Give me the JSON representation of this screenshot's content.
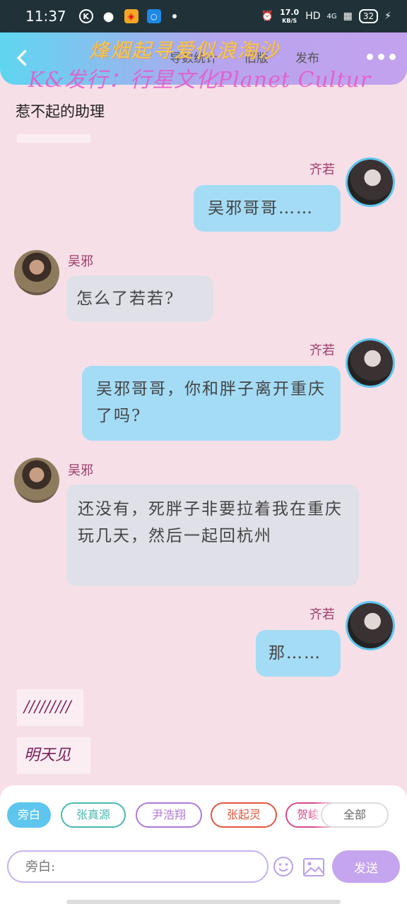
{
  "status_bar": {
    "time": "11:37",
    "speed_value": "17.0",
    "speed_unit": "KB/S",
    "network": "HD",
    "signal": "4G",
    "battery": "32"
  },
  "header": {
    "watermark_title": "烽烟起寻爱似浪淘沙",
    "watermark_credit": "K&发行：行星文化Planet Cultur",
    "tabs": [
      "导数统计",
      "旧版",
      "发布"
    ]
  },
  "chat": {
    "top_note": "惹不起的助理",
    "messages": [
      {
        "sender": "齐若",
        "text": "吴邪哥哥……",
        "side": "me"
      },
      {
        "sender": "吴邪",
        "text": "怎么了若若?",
        "side": "other"
      },
      {
        "sender": "齐若",
        "text": "吴邪哥哥，你和胖子离开重庆了吗?",
        "side": "me"
      },
      {
        "sender": "吴邪",
        "text": "还没有，死胖子非要拉着我在重庆玩几天，然后一起回杭州",
        "side": "other"
      },
      {
        "sender": "齐若",
        "text": "那……",
        "side": "me"
      }
    ],
    "system_notes": [
      "/////////",
      "明天见"
    ]
  },
  "composer": {
    "chips": [
      {
        "label": "旁白",
        "color": "#5ec6ee"
      },
      {
        "label": "张真源",
        "color": "#4ab9b0"
      },
      {
        "label": "尹浩翔",
        "color": "#b07ad6"
      },
      {
        "label": "张起灵",
        "color": "#e0583f"
      },
      {
        "label": "贺峻",
        "color": "#d64a8a"
      },
      {
        "label": "全部",
        "color": "#cccccc"
      }
    ],
    "input_placeholder": "旁白:",
    "send_label": "发送"
  }
}
